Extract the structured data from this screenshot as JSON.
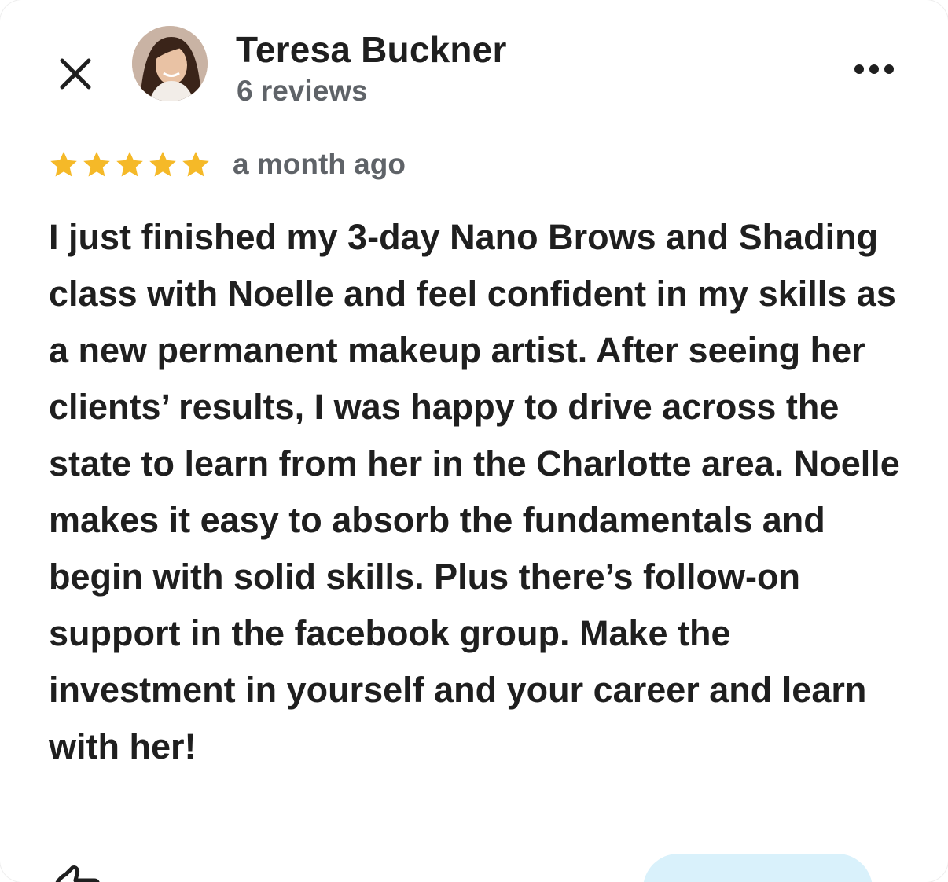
{
  "reviewer": {
    "name": "Teresa Buckner",
    "review_count": "6 reviews"
  },
  "review": {
    "rating": 5,
    "max_rating": 5,
    "time": "a month ago",
    "text": "I just finished my 3-day Nano Brows and Shading class with Noelle and feel confident in my skills as a new permanent makeup artist. After seeing her clients’ results, I was happy to drive across the state to learn from her in the Charlotte area. Noelle makes it easy to absorb the fundamentals and begin with solid skills. Plus there’s follow-on support in the facebook group. Make the investment in yourself and your career and learn with her!"
  },
  "icons": {
    "close": "close-icon",
    "more": "more-options-icon",
    "star": "star-icon",
    "like": "thumbs-up-icon"
  },
  "colors": {
    "star": "#f5b928",
    "text": "#1f1f1f",
    "secondary_text": "#5f6368",
    "pill": "#d9f1fb"
  }
}
